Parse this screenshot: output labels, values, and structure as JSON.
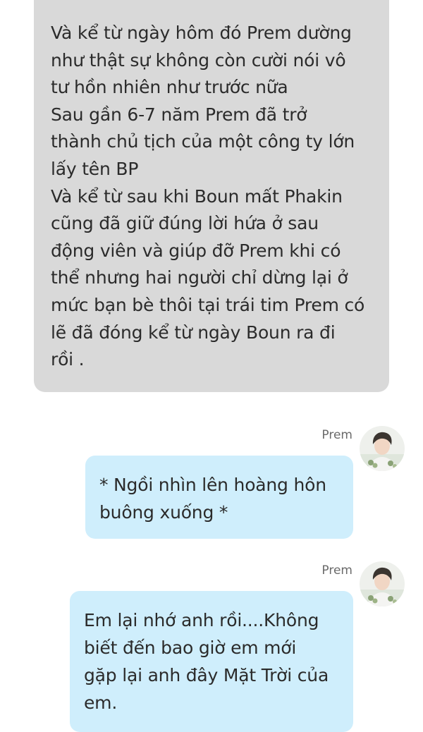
{
  "narrator": {
    "text": "Và kể từ ngày hôm đó Prem dường\nnhư thật sự không còn cười nói vô\ntư hồn nhiên như trước nữa\nSau gần 6-7 năm Prem đã trở\nthành chủ tịch của một công ty lớn\nlấy tên BP\nVà kể từ sau khi Boun mất Phakin\ncũng đã giữ đúng lời hứa ở sau\nđộng viên và giúp đỡ Prem khi có\nthể nhưng hai người chỉ dừng lại ở\nmức bạn bè thôi tại trái tim Prem có\nlẽ đã đóng kể từ ngày Boun ra đi\nrồi ."
  },
  "messages": [
    {
      "sender": "Prem",
      "text": "* Ngồi nhìn lên hoàng hôn\nbuông xuống *"
    },
    {
      "sender": "Prem",
      "text": "Em lại nhớ anh rồi....Không\nbiết đến bao giờ em mới\ngặp lại anh đây Mặt Trời của\nem."
    }
  ],
  "colors": {
    "narrator_bubble": "#d9d9d9",
    "user_bubble": "#cfeefc",
    "background": "#ffffff"
  },
  "icons": {
    "avatar": "avatar-photo-icon"
  }
}
